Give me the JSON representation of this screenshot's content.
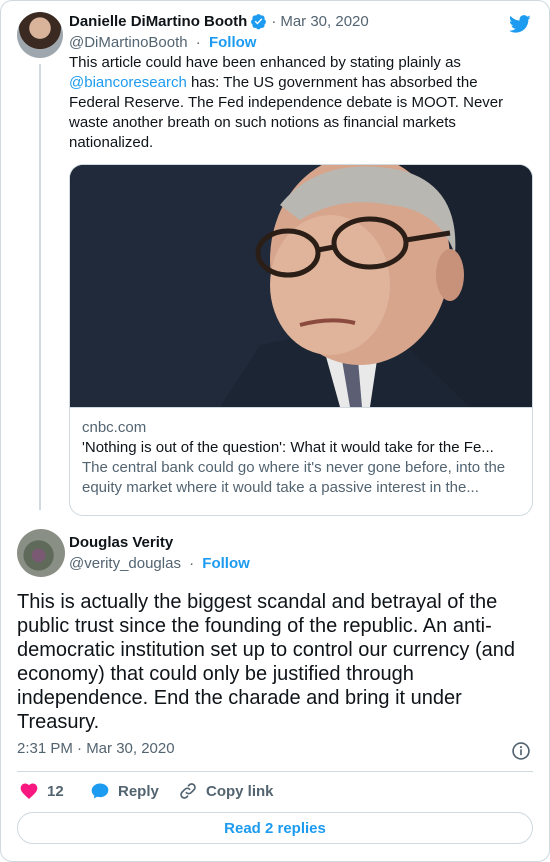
{
  "tweet1": {
    "author_name": "Danielle DiMartino Booth",
    "date": "Mar 30, 2020",
    "separator": "·",
    "handle": "@DiMartinoBooth",
    "follow_label": "Follow",
    "text_before_mention": "This article could have been enhanced by stating plainly as ",
    "mention": "@biancoresearch",
    "text_after_mention": " has: The US government has absorbed the Federal Reserve. The Fed independence debate is MOOT. Never waste another breath on such notions as financial markets nationalized.",
    "card": {
      "domain": "cnbc.com",
      "title": "'Nothing is out of the question': What it would take for the Fe...",
      "description": "The central bank could go where it's never gone before, into the equity market where it would take a passive interest in the..."
    }
  },
  "tweet2": {
    "author_name": "Douglas Verity",
    "handle": "@verity_douglas",
    "separator": "·",
    "follow_label": "Follow",
    "text": "This is actually the biggest scandal and betrayal of the public trust since the founding of the republic.  An anti-democratic institution set up to control our currency (and economy) that could only be justified through independence.  End the charade and bring it under Treasury.",
    "timestamp": "2:31 PM · Mar 30, 2020"
  },
  "actions": {
    "like_count": "12",
    "reply_label": "Reply",
    "copy_link_label": "Copy link"
  },
  "read_replies_label": "Read 2 replies",
  "icons": {
    "verified": "verified-badge-icon",
    "bird": "twitter-bird-icon",
    "info": "info-icon",
    "heart": "heart-icon",
    "reply": "speech-bubble-icon",
    "link": "link-icon"
  },
  "colors": {
    "accent": "#1d9bf0",
    "like": "#f91880",
    "text": "#0f1419",
    "muted": "#536471",
    "border": "#cfd9de"
  }
}
